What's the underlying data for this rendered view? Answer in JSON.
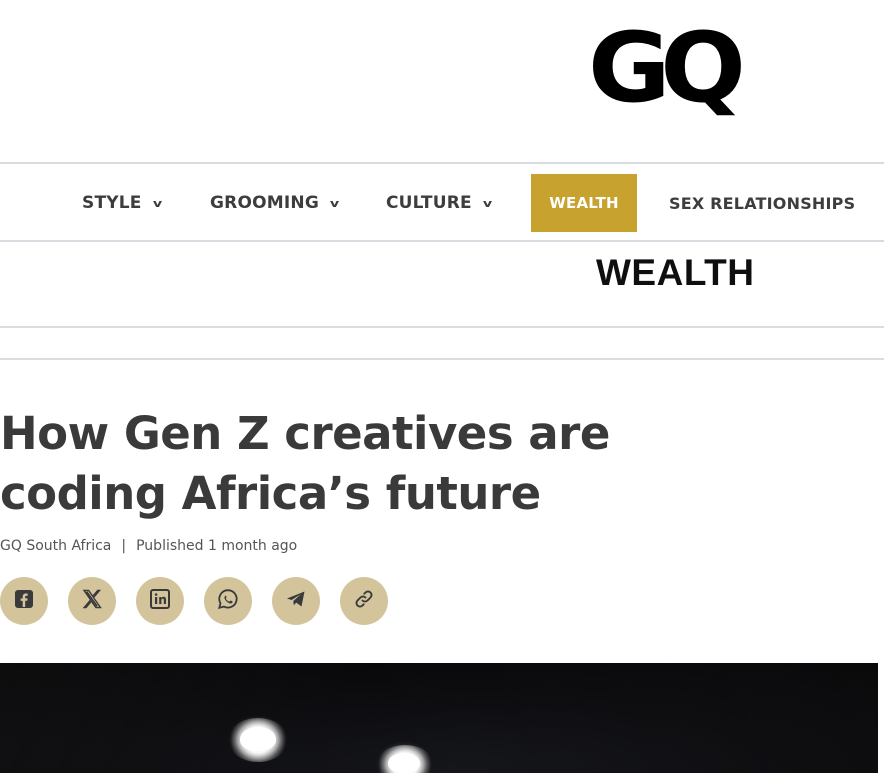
{
  "logo": {
    "text": "GQ"
  },
  "nav": {
    "items": [
      {
        "label": "STYLE",
        "has_dropdown": true
      },
      {
        "label": "GROOMING",
        "has_dropdown": true
      },
      {
        "label": "CULTURE",
        "has_dropdown": true
      },
      {
        "label": "WEALTH",
        "has_dropdown": false,
        "active": true
      },
      {
        "label": "SEX RELATIONSHIPS",
        "has_dropdown": false
      }
    ],
    "active_color": "#c8a22f"
  },
  "section": {
    "title": "WEALTH"
  },
  "article": {
    "headline": "How Gen Z creatives are coding Africa’s future",
    "author": "GQ South Africa",
    "separator": "|",
    "published": "Published 1 month ago"
  },
  "share": {
    "buttons": [
      {
        "name": "facebook-icon"
      },
      {
        "name": "x-icon"
      },
      {
        "name": "linkedin-icon"
      },
      {
        "name": "whatsapp-icon"
      },
      {
        "name": "telegram-icon"
      },
      {
        "name": "copy-link-icon"
      }
    ],
    "button_color": "#d3c49c"
  }
}
